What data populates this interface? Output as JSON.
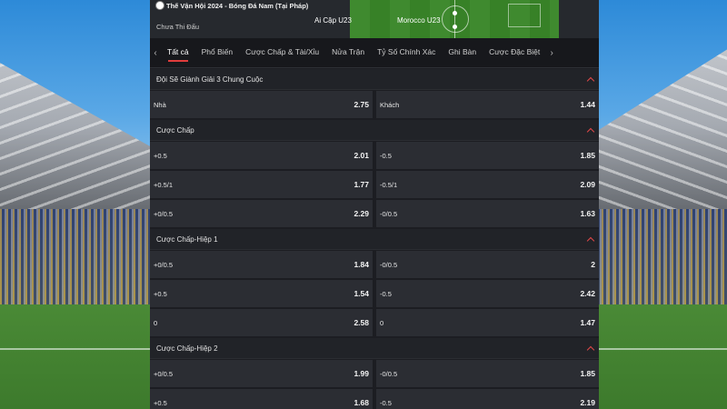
{
  "match": {
    "competition": "Thế Vận Hội 2024 - Bóng Đá Nam (Tại Pháp)",
    "status": "Chưa Thi Đấu",
    "home_team": "Ai Cập U23",
    "away_team": "Morocco U23"
  },
  "tabs": [
    "Tất cả",
    "Phổ Biến",
    "Cược Chấp & Tài/Xỉu",
    "Nửa Trận",
    "Tỷ Số Chính Xác",
    "Ghi Bàn",
    "Cược Đặc Biệt"
  ],
  "active_tab": "Tất cả",
  "colors": {
    "accent": "#e03c3c",
    "panel": "#1c1d22",
    "cell": "#2b2d33"
  },
  "markets": [
    {
      "title": "Đội Sẽ Giành Giải 3 Chung Cuộc",
      "rows": [
        {
          "left": {
            "label": "Nhà",
            "odds": "2.75"
          },
          "right": {
            "label": "Khách",
            "odds": "1.44"
          }
        }
      ]
    },
    {
      "title": "Cược Chấp",
      "rows": [
        {
          "left": {
            "label": "+0.5",
            "odds": "2.01"
          },
          "right": {
            "label": "-0.5",
            "odds": "1.85"
          }
        },
        {
          "left": {
            "label": "+0.5/1",
            "odds": "1.77"
          },
          "right": {
            "label": "-0.5/1",
            "odds": "2.09"
          }
        },
        {
          "left": {
            "label": "+0/0.5",
            "odds": "2.29"
          },
          "right": {
            "label": "-0/0.5",
            "odds": "1.63"
          }
        }
      ]
    },
    {
      "title": "Cược Chấp-Hiệp 1",
      "rows": [
        {
          "left": {
            "label": "+0/0.5",
            "odds": "1.84"
          },
          "right": {
            "label": "-0/0.5",
            "odds": "2"
          }
        },
        {
          "left": {
            "label": "+0.5",
            "odds": "1.54"
          },
          "right": {
            "label": "-0.5",
            "odds": "2.42"
          }
        },
        {
          "left": {
            "label": "0",
            "odds": "2.58"
          },
          "right": {
            "label": "0",
            "odds": "1.47"
          }
        }
      ]
    },
    {
      "title": "Cược Chấp-Hiệp 2",
      "rows": [
        {
          "left": {
            "label": "+0/0.5",
            "odds": "1.99"
          },
          "right": {
            "label": "-0/0.5",
            "odds": "1.85"
          }
        },
        {
          "left": {
            "label": "+0.5",
            "odds": "1.68"
          },
          "right": {
            "label": "-0.5",
            "odds": "2.19"
          }
        }
      ]
    }
  ]
}
